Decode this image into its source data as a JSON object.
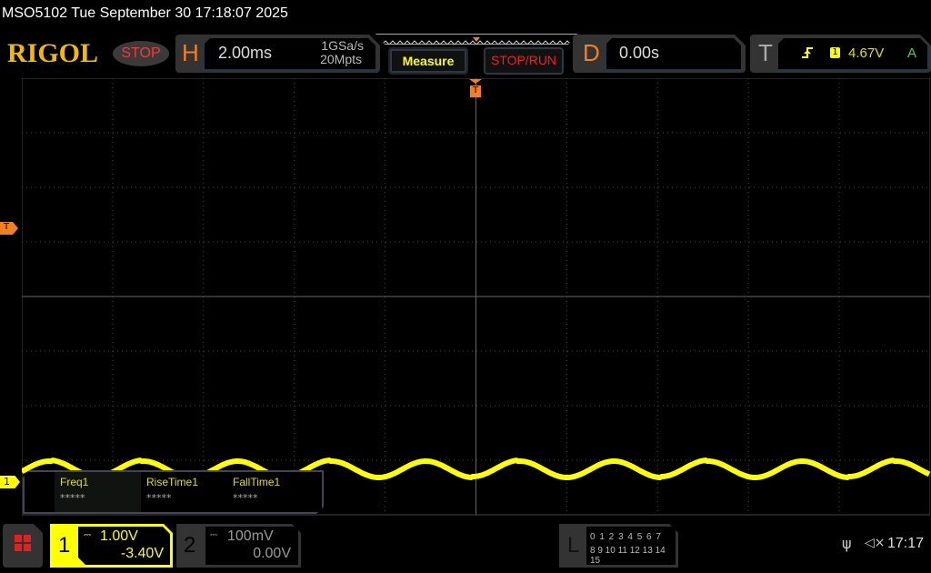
{
  "title": "MSO5102  Tue September 30 17:18:07 2025",
  "logo": "RIGOL",
  "run_state": "STOP",
  "horizontal": {
    "letter": "H",
    "timebase": "2.00ms",
    "sample_rate": "1GSa/s",
    "memory_depth": "20Mpts"
  },
  "buttons": {
    "measure": "Measure",
    "stop_run": "STOP/RUN"
  },
  "delay": {
    "letter": "D",
    "value": "0.00s"
  },
  "trigger": {
    "letter": "T",
    "slope_icon": "rising-edge-icon",
    "source": "1",
    "level": "4.67V",
    "mode": "A",
    "marker": "T"
  },
  "measurements": [
    {
      "name": "Freq1",
      "value": "*****"
    },
    {
      "name": "RiseTime1",
      "value": "*****"
    },
    {
      "name": "FallTime1",
      "value": "*****"
    }
  ],
  "channel1": {
    "number": "1",
    "scale": "1.00V",
    "offset": "-3.40V",
    "coupling_icon": "dc-coupling-icon",
    "color": "#ffff00"
  },
  "channel2": {
    "number": "2",
    "scale": "100mV",
    "offset": "0.00V",
    "coupling_icon": "dc-coupling-icon"
  },
  "logic": {
    "letter": "L",
    "row1": "0 1 2 3   4 5 6 7",
    "row2": "8 9 10 11 12 13 14 15"
  },
  "status": {
    "usb_icon": "usb-icon",
    "sound_icon": "mute-icon",
    "time": "17:17"
  },
  "colors": {
    "trace": "#ffff00",
    "accent": "#f08020",
    "stop": "#f03c3c",
    "logo": "#f5b800"
  }
}
